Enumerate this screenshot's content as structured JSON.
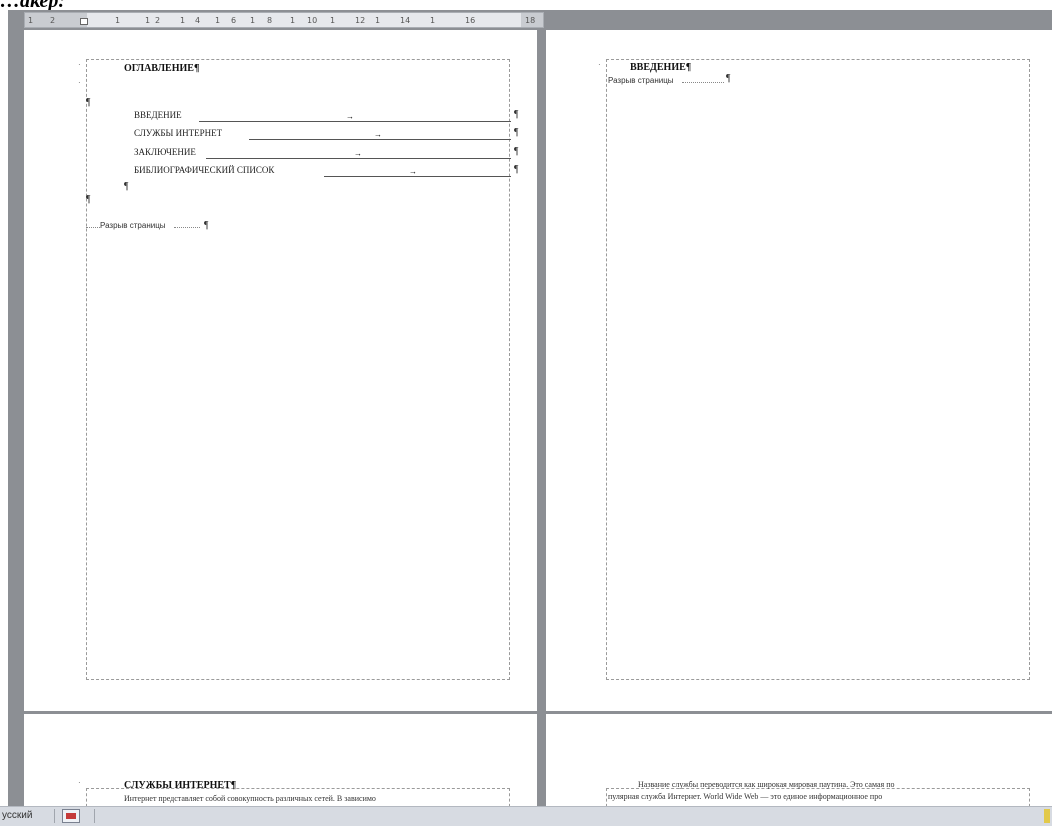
{
  "caption": "…акер:",
  "ruler": {
    "ticks": [
      "1",
      "2",
      "1",
      "1",
      "2",
      "1",
      "4",
      "1",
      "6",
      "1",
      "8",
      "1",
      "10",
      "1",
      "12",
      "1",
      "14",
      "1",
      "16",
      "18"
    ]
  },
  "page1": {
    "heading": "ОГЛАВЛЕНИЕ¶",
    "toc": [
      {
        "label": "ВВЕДЕНИЕ",
        "mark": "¶"
      },
      {
        "label": "СЛУЖБЫ ИНТЕРНЕТ",
        "mark": "¶"
      },
      {
        "label": "ЗАКЛЮЧЕНИЕ",
        "mark": "¶"
      },
      {
        "label": "БИБЛИОГРАФИЧЕСКИЙ СПИСОК",
        "mark": "¶"
      }
    ],
    "pilcrow": "¶",
    "page_break": "Разрыв страницы"
  },
  "page2": {
    "heading": "ВВЕДЕНИЕ¶",
    "page_break": "Разрыв страницы"
  },
  "page3": {
    "heading": "СЛУЖБЫ ИНТЕРНЕТ¶",
    "body_line1": "Интернет представляет собой совокупность различных сетей. В зависимо"
  },
  "page4": {
    "body_line1": "Название службы переводится как широкая мировая паутина. Это самая по",
    "body_line2": "пулярная служба Интернет. World Wide Web — это единое информационное про"
  },
  "statusbar": {
    "language": "усский"
  }
}
